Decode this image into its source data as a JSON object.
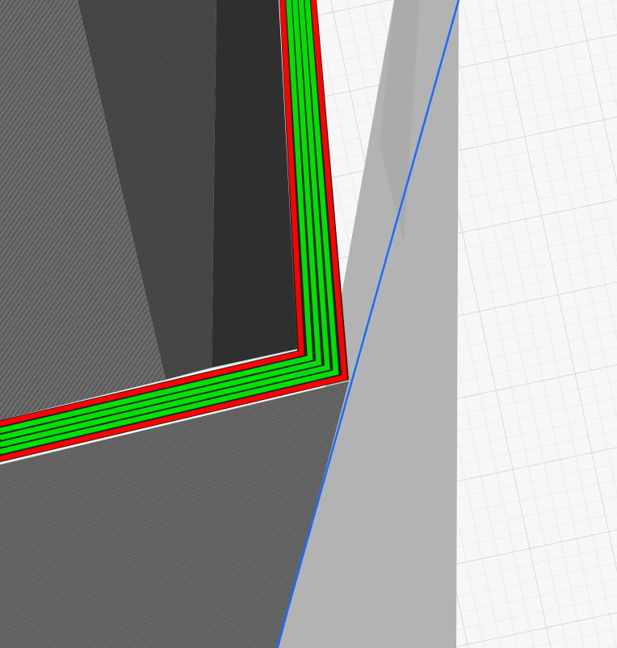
{
  "viewport": {
    "colors": {
      "bed_background": "#f7f7f7",
      "bed_grid_major": "#cfcfcf",
      "bed_grid_minor": "#e6e6e6",
      "shadow_light": "#b3b3b3",
      "shadow_dark": "#a4a4a4",
      "model_wall_light": "#6a6a6a",
      "model_wall_dark": "#3a3a3a",
      "model_interior_dark": "#2f2f2f",
      "perimeter_outer": "#ff0000",
      "perimeter_inner": "#00e000",
      "perimeter_gap": "#1f1f1f",
      "build_volume_edge": "#1a6cff"
    },
    "toolpath": {
      "outer_wall_lines": 2,
      "inner_wall_lines": 4
    }
  }
}
